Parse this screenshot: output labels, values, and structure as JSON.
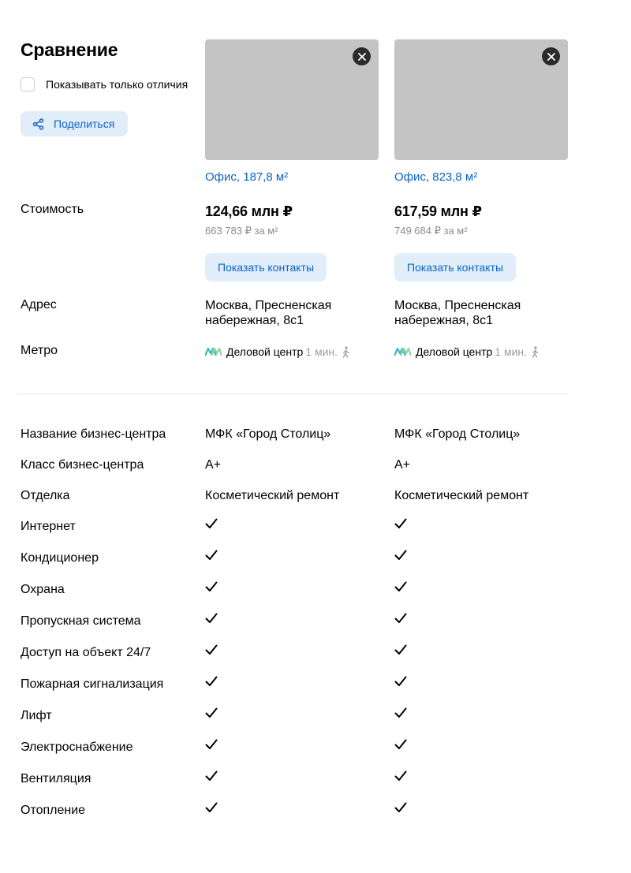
{
  "header": {
    "title": "Сравнение",
    "only_differences_label": "Показывать только отличия",
    "share_label": "Поделиться"
  },
  "offers": [
    {
      "title": "Офис, 187,8 м²",
      "price": "124,66 млн ₽",
      "price_per_m": "663 783 ₽ за м²",
      "contacts_label": "Показать контакты",
      "address": "Москва, Пресненская набережная, 8с1",
      "metro_station": "Деловой центр",
      "metro_time": "1 мин."
    },
    {
      "title": "Офис, 823,8 м²",
      "price": "617,59 млн ₽",
      "price_per_m": "749 684 ₽ за м²",
      "contacts_label": "Показать контакты",
      "address": "Москва, Пресненская набережная, 8с1",
      "metro_station": "Деловой центр",
      "metro_time": "1 мин."
    }
  ],
  "row_labels": {
    "price": "Стоимость",
    "address": "Адрес",
    "metro": "Метро"
  },
  "specs": [
    {
      "label": "Название бизнес-центра",
      "values": [
        "МФК «Город Столиц»",
        "МФК «Город Столиц»"
      ]
    },
    {
      "label": "Класс бизнес-центра",
      "values": [
        "A+",
        "A+"
      ]
    },
    {
      "label": "Отделка",
      "values": [
        "Косметический ремонт",
        "Косметический ремонт"
      ]
    },
    {
      "label": "Интернет",
      "values": [
        true,
        true
      ]
    },
    {
      "label": "Кондиционер",
      "values": [
        true,
        true
      ]
    },
    {
      "label": "Охрана",
      "values": [
        true,
        true
      ]
    },
    {
      "label": "Пропускная система",
      "values": [
        true,
        true
      ]
    },
    {
      "label": "Доступ на объект 24/7",
      "values": [
        true,
        true
      ]
    },
    {
      "label": "Пожарная сигнализация",
      "values": [
        true,
        true
      ]
    },
    {
      "label": "Лифт",
      "values": [
        true,
        true
      ]
    },
    {
      "label": "Электроснабжение",
      "values": [
        true,
        true
      ]
    },
    {
      "label": "Вентиляция",
      "values": [
        true,
        true
      ]
    },
    {
      "label": "Отопление",
      "values": [
        true,
        true
      ]
    }
  ],
  "icons": {
    "remove": "close-icon",
    "share": "share-icon",
    "metro": "metro-icon",
    "walk": "walk-icon",
    "check": "check-icon"
  },
  "colors": {
    "accent": "#0b63c8",
    "button_bg": "#e1edf9",
    "photo_placeholder": "#c4c4c4",
    "muted_text": "#8c8c8c",
    "metro_line": "#3fb6c6"
  }
}
